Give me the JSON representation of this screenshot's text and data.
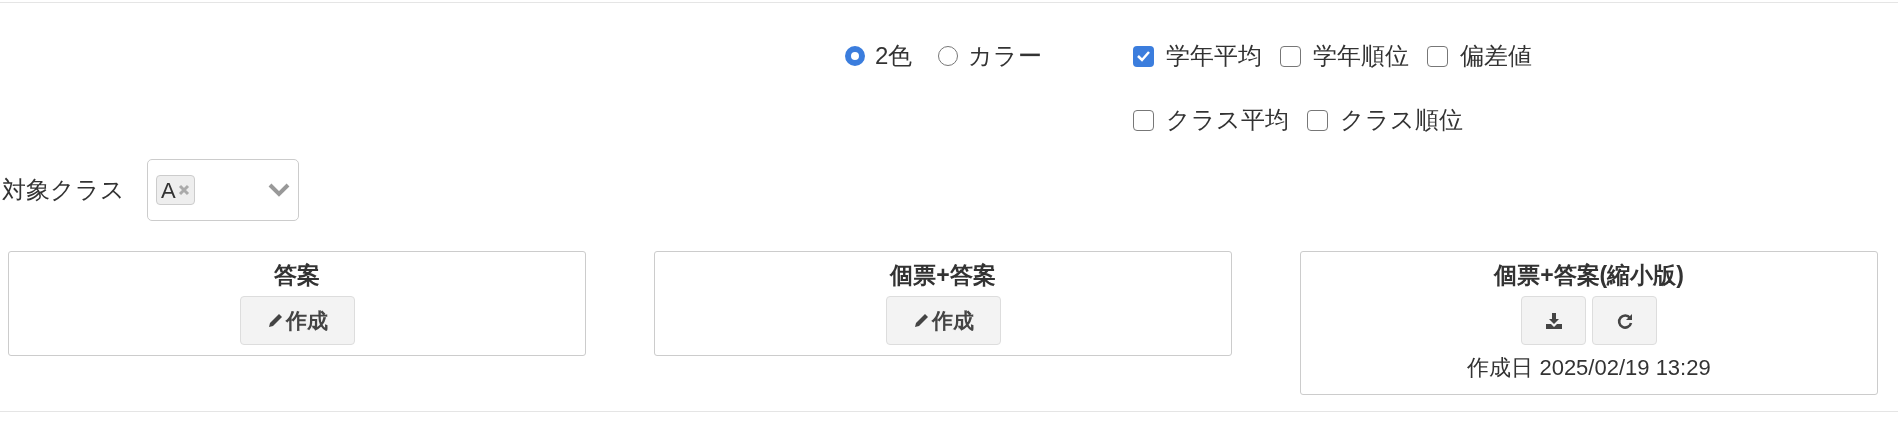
{
  "color_mode": [
    {
      "label": "2色",
      "selected": true
    },
    {
      "label": "カラー",
      "selected": false
    }
  ],
  "options": [
    [
      {
        "label": "学年平均",
        "checked": true
      },
      {
        "label": "学年順位",
        "checked": false
      },
      {
        "label": "偏差値",
        "checked": false
      }
    ],
    [
      {
        "label": "クラス平均",
        "checked": false
      },
      {
        "label": "クラス順位",
        "checked": false
      }
    ]
  ],
  "class_filter": {
    "label": "対象クラス",
    "tags": [
      "A"
    ]
  },
  "cards": [
    {
      "title": "答案",
      "kind": "create",
      "button": "作成"
    },
    {
      "title": "個票+答案",
      "kind": "create",
      "button": "作成"
    },
    {
      "title": "個票+答案(縮小版)",
      "kind": "download",
      "caption": "作成日 2025/02/19 13:29"
    }
  ]
}
